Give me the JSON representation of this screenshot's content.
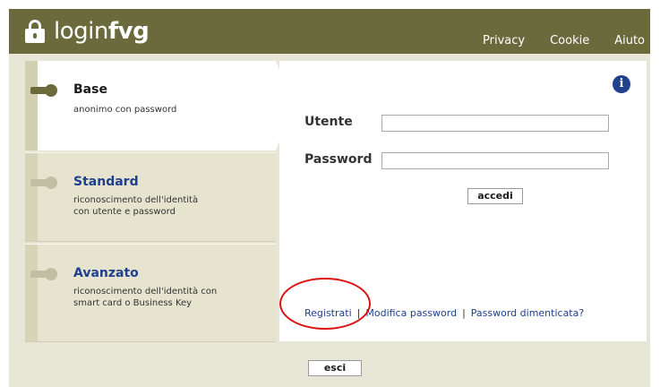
{
  "header": {
    "brand_light": "login",
    "brand_bold": "fvg",
    "nav": [
      "Privacy",
      "Cookie",
      "Aiuto"
    ]
  },
  "tabs": [
    {
      "title": "Base",
      "desc": [
        "anonimo con password"
      ]
    },
    {
      "title": "Standard",
      "desc": [
        "riconoscimento dell'identità",
        "con utente e password"
      ]
    },
    {
      "title": "Avanzato",
      "desc": [
        "riconoscimento dell'identità con",
        "smart card o Business Key"
      ]
    }
  ],
  "form": {
    "user_label": "Utente",
    "password_label": "Password",
    "user_value": "",
    "password_value": "",
    "submit_label": "accedi"
  },
  "links": {
    "register": "Registrati",
    "change_password": "Modifica password",
    "forgot_password": "Password dimenticata?",
    "separator": "|"
  },
  "exit_label": "esci",
  "info_icon": "i",
  "colors": {
    "header": "#6b6a3d",
    "background": "#e8e6d6",
    "link": "#1f3f8f",
    "highlight": "#dd1111"
  }
}
